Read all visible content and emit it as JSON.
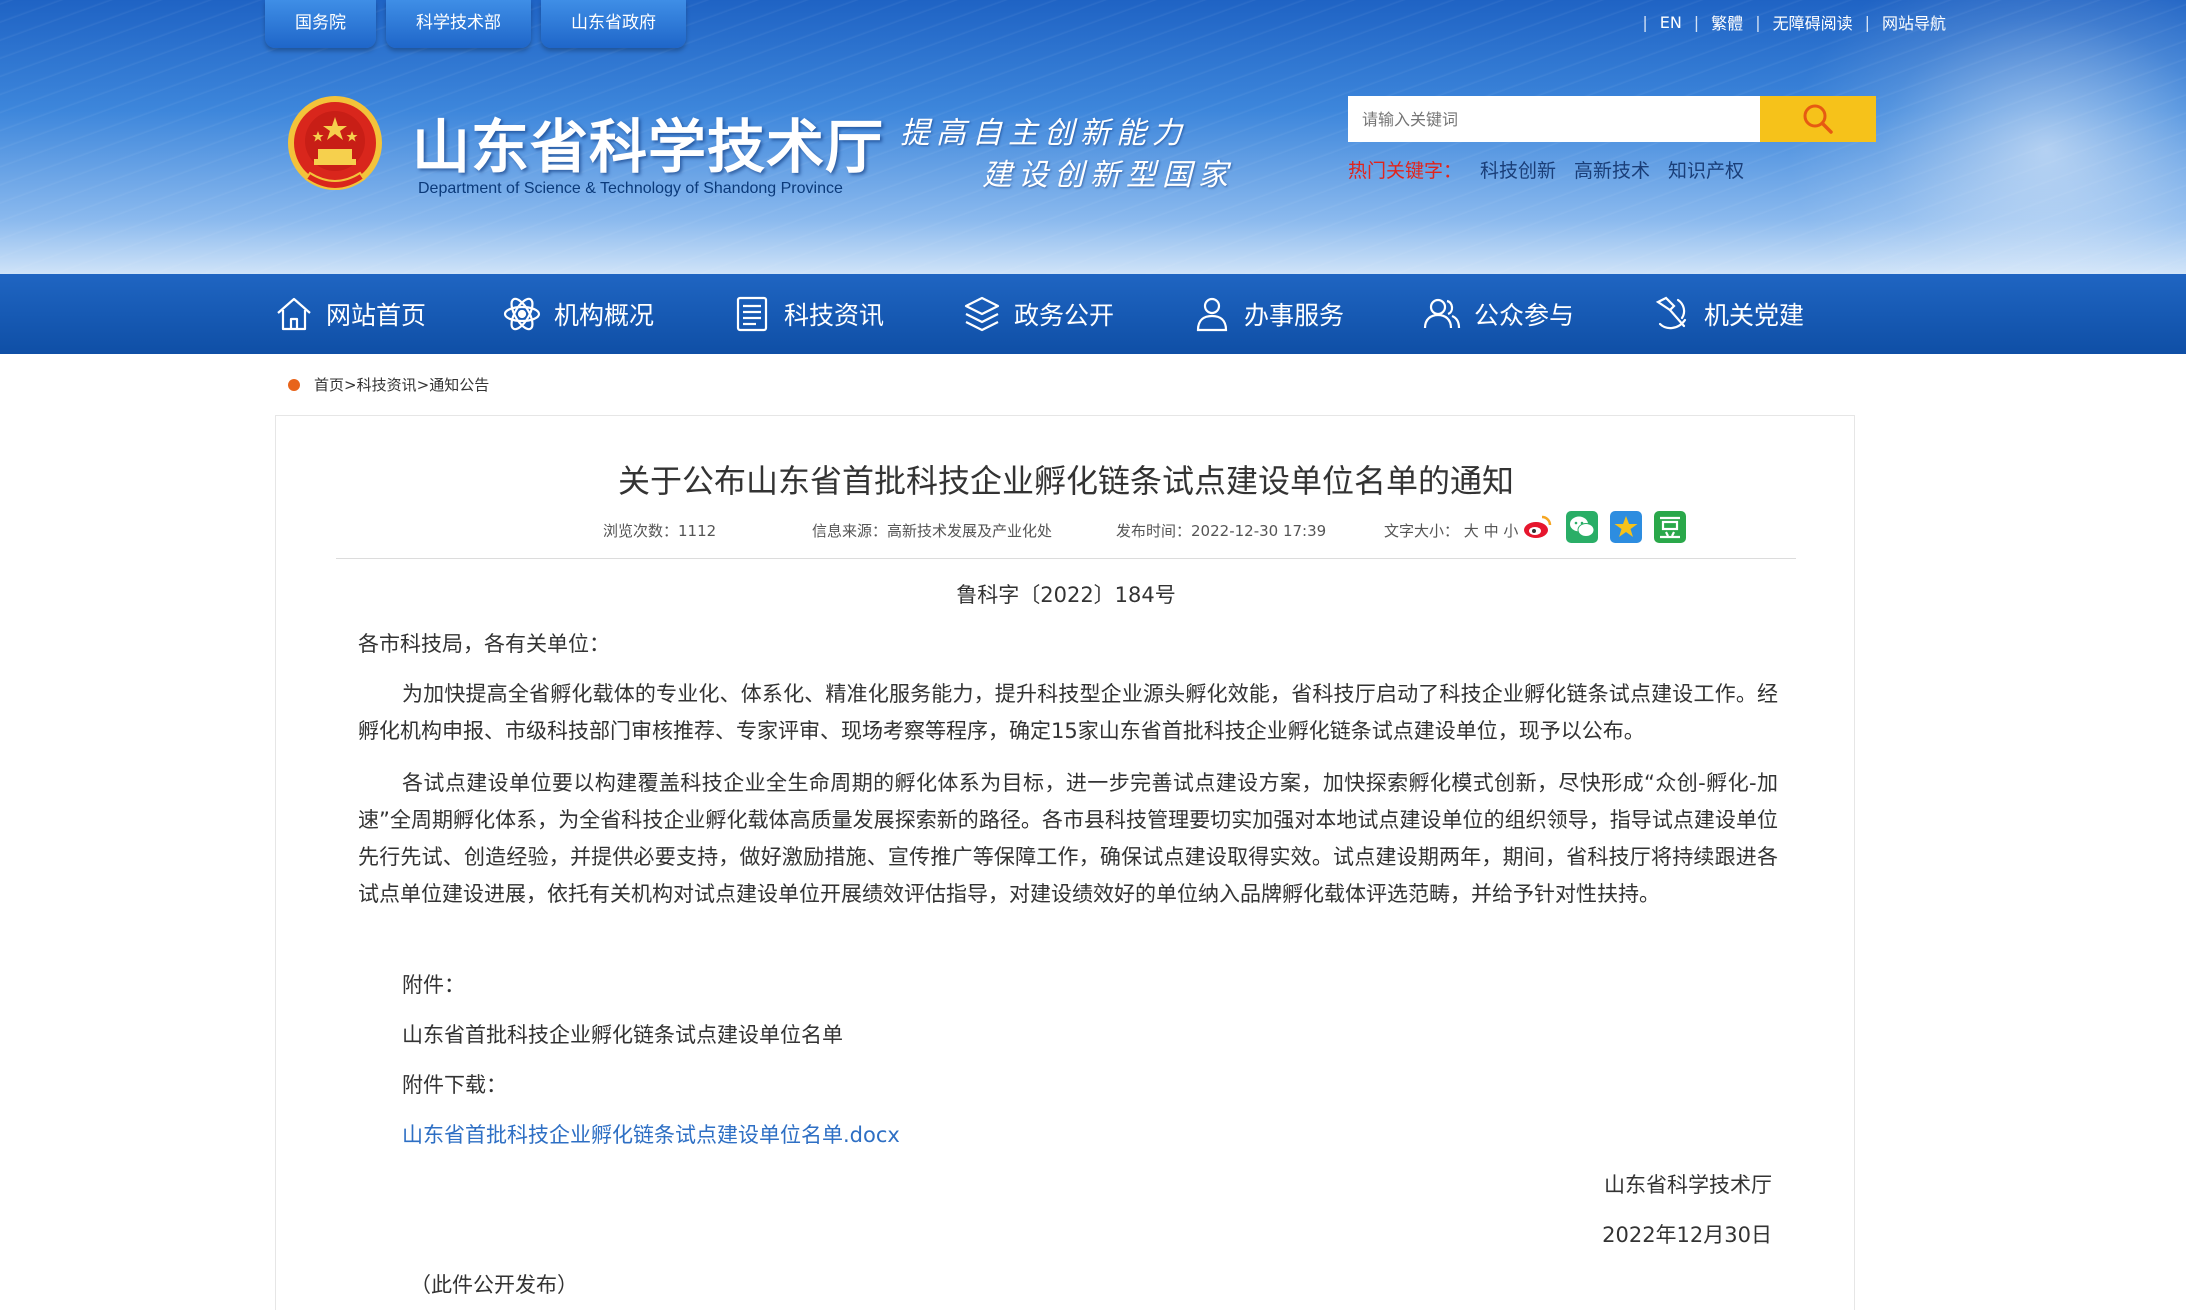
{
  "top_tabs": [
    "国务院",
    "科学技术部",
    "山东省政府"
  ],
  "top_links": [
    "EN",
    "繁體",
    "无障碍阅读",
    "网站导航"
  ],
  "site": {
    "title": "山东省科学技术厅",
    "subtitle": "Department of Science & Technology of Shandong Province",
    "slogan_line1": "提高自主创新能力",
    "slogan_line2": "建设创新型国家"
  },
  "search": {
    "placeholder": "请输入关键词",
    "hot_label": "热门关键字：",
    "hot_words": [
      "科技创新",
      "高新技术",
      "知识产权"
    ]
  },
  "nav": [
    {
      "label": "网站首页",
      "icon": "home-icon"
    },
    {
      "label": "机构概况",
      "icon": "atom-icon"
    },
    {
      "label": "科技资讯",
      "icon": "news-icon"
    },
    {
      "label": "政务公开",
      "icon": "layers-icon"
    },
    {
      "label": "办事服务",
      "icon": "user-service-icon"
    },
    {
      "label": "公众参与",
      "icon": "people-icon"
    },
    {
      "label": "机关党建",
      "icon": "party-emblem-icon"
    }
  ],
  "breadcrumb": [
    "首页",
    "科技资讯",
    "通知公告"
  ],
  "breadcrumb_sep": ">",
  "article": {
    "title": "关于公布山东省首批科技企业孵化链条试点建设单位名单的通知",
    "views_label": "浏览次数：",
    "views": "1112",
    "source_label": "信息来源：",
    "source": "高新技术发展及产业化处",
    "date_label": "发布时间：",
    "date": "2022-12-30 17:39",
    "font_label": "文字大小：",
    "font_sizes": [
      "大",
      "中",
      "小"
    ],
    "doc_number": "鲁科字〔2022〕184号",
    "salutation": "各市科技局，各有关单位：",
    "para1": "为加快提高全省孵化载体的专业化、体系化、精准化服务能力，提升科技型企业源头孵化效能，省科技厅启动了科技企业孵化链条试点建设工作。经孵化机构申报、市级科技部门审核推荐、专家评审、现场考察等程序，确定15家山东省首批科技企业孵化链条试点建设单位，现予以公布。",
    "para2": "各试点建设单位要以构建覆盖科技企业全生命周期的孵化体系为目标，进一步完善试点建设方案，加快探索孵化模式创新，尽快形成“众创-孵化-加速”全周期孵化体系，为全省科技企业孵化载体高质量发展探索新的路径。各市县科技管理要切实加强对本地试点建设单位的组织领导，指导试点建设单位先行先试、创造经验，并提供必要支持，做好激励措施、宣传推广等保障工作，确保试点建设取得实效。试点建设期两年，期间，省科技厅将持续跟进各试点单位建设进展，依托有关机构对试点建设单位开展绩效评估指导，对建设绩效好的单位纳入品牌孵化载体评选范畴，并给予针对性扶持。",
    "attach_label": "附件：",
    "attach_name": "山东省首批科技企业孵化链条试点建设单位名单",
    "download_label": "附件下载：",
    "download_file": "山东省首批科技企业孵化链条试点建设单位名单.docx",
    "signature": "山东省科学技术厅",
    "sign_date": "2022年12月30日",
    "publish_note": "（此件公开发布）"
  },
  "colors": {
    "nav_bg": "#0f4fa6",
    "search_button": "#f6c21a",
    "hot_label": "#e2231a",
    "link": "#2e6fc4",
    "breadcrumb_dot": "#e8641b"
  }
}
